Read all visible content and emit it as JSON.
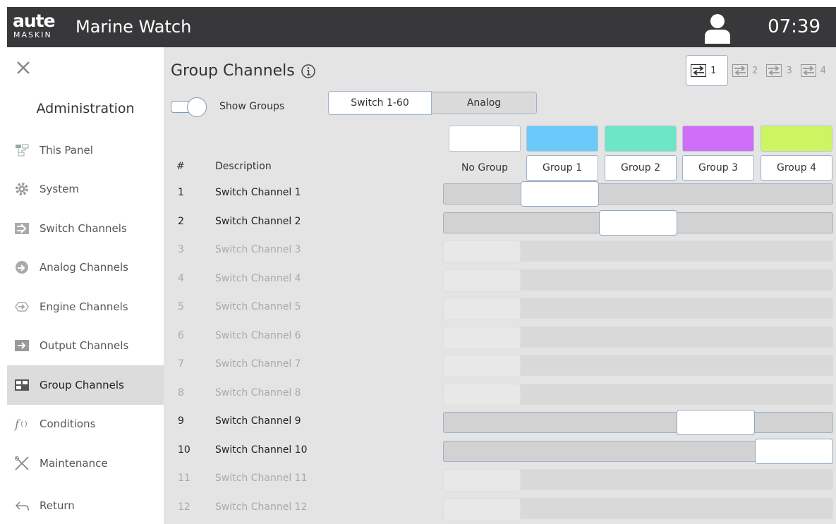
{
  "header": {
    "logo_main": "aute",
    "logo_sub": "MASKIN",
    "title": "Marine Watch",
    "time": "07:39"
  },
  "sidebar": {
    "title": "Administration",
    "items": [
      {
        "label": "This Panel",
        "icon": "panel-icon"
      },
      {
        "label": "System",
        "icon": "gear-icon"
      },
      {
        "label": "Switch Channels",
        "icon": "switch-icon"
      },
      {
        "label": "Analog Channels",
        "icon": "analog-icon"
      },
      {
        "label": "Engine Channels",
        "icon": "engine-icon"
      },
      {
        "label": "Output Channels",
        "icon": "output-icon"
      },
      {
        "label": "Group Channels",
        "icon": "group-icon",
        "active": true
      },
      {
        "label": "Conditions",
        "icon": "function-icon"
      },
      {
        "label": "Maintenance",
        "icon": "tools-icon"
      }
    ],
    "return_label": "Return"
  },
  "main": {
    "title": "Group Channels",
    "show_groups_label": "Show Groups",
    "show_groups_on": true,
    "tabs": [
      {
        "label": "Switch 1-60",
        "active": true
      },
      {
        "label": "Analog",
        "active": false
      }
    ],
    "pages": [
      "1",
      "2",
      "3",
      "4"
    ],
    "active_page": "1",
    "col_num": "#",
    "col_desc": "Description",
    "groups": [
      {
        "label": "No Group",
        "color": "#ffffff"
      },
      {
        "label": "Group 1",
        "color": "#6ccafa"
      },
      {
        "label": "Group 2",
        "color": "#6de6c6"
      },
      {
        "label": "Group 3",
        "color": "#cf6ef7"
      },
      {
        "label": "Group 4",
        "color": "#cdf561"
      }
    ],
    "channels": [
      {
        "num": "1",
        "desc": "Switch Channel 1",
        "enabled": true,
        "group": 1
      },
      {
        "num": "2",
        "desc": "Switch Channel 2",
        "enabled": true,
        "group": 2
      },
      {
        "num": "3",
        "desc": "Switch Channel 3",
        "enabled": false,
        "group": 0
      },
      {
        "num": "4",
        "desc": "Switch Channel 4",
        "enabled": false,
        "group": 0
      },
      {
        "num": "5",
        "desc": "Switch Channel 5",
        "enabled": false,
        "group": 0
      },
      {
        "num": "6",
        "desc": "Switch Channel 6",
        "enabled": false,
        "group": 0
      },
      {
        "num": "7",
        "desc": "Switch Channel 7",
        "enabled": false,
        "group": 0
      },
      {
        "num": "8",
        "desc": "Switch Channel 8",
        "enabled": false,
        "group": 0
      },
      {
        "num": "9",
        "desc": "Switch Channel 9",
        "enabled": true,
        "group": 3
      },
      {
        "num": "10",
        "desc": "Switch Channel 10",
        "enabled": true,
        "group": 4
      },
      {
        "num": "11",
        "desc": "Switch Channel 11",
        "enabled": false,
        "group": 0
      },
      {
        "num": "12",
        "desc": "Switch Channel 12",
        "enabled": false,
        "group": 0
      }
    ]
  }
}
